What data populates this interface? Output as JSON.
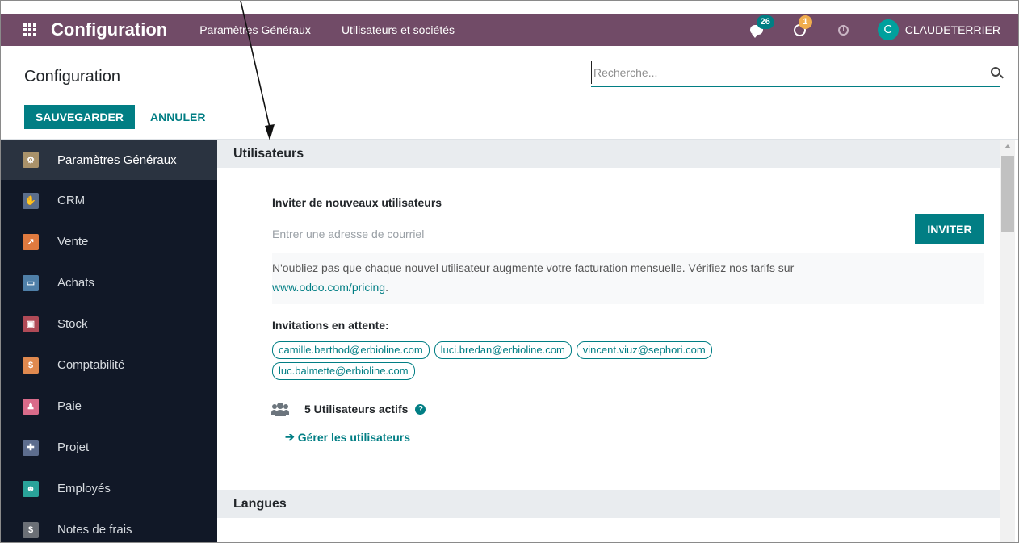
{
  "navbar": {
    "brand": "Configuration",
    "menu": [
      "Paramètres Généraux",
      "Utilisateurs et sociétés"
    ],
    "messages_count": "26",
    "activities_count": "1",
    "avatar_letter": "C",
    "user_name": "CLAUDETERRIER",
    "icons": [
      "apps-grid-icon",
      "chat-icon",
      "activity-icon",
      "clock-icon"
    ]
  },
  "control_panel": {
    "title": "Configuration",
    "search_placeholder": "Recherche...",
    "save_label": "SAUVEGARDER",
    "cancel_label": "ANNULER"
  },
  "sidebar": {
    "items": [
      {
        "label": "Paramètres Généraux",
        "color": "#a9926a",
        "glyph": "⚙"
      },
      {
        "label": "CRM",
        "color": "#5b6e8c",
        "glyph": "✋"
      },
      {
        "label": "Vente",
        "color": "#e07a3f",
        "glyph": "↗"
      },
      {
        "label": "Achats",
        "color": "#4f7fa8",
        "glyph": "▭"
      },
      {
        "label": "Stock",
        "color": "#b04a57",
        "glyph": "▣"
      },
      {
        "label": "Comptabilité",
        "color": "#e0894f",
        "glyph": "$"
      },
      {
        "label": "Paie",
        "color": "#d96b8a",
        "glyph": "♟"
      },
      {
        "label": "Projet",
        "color": "#5d6d8e",
        "glyph": "✚"
      },
      {
        "label": "Employés",
        "color": "#2aa39a",
        "glyph": "☻"
      },
      {
        "label": "Notes de frais",
        "color": "#6b6f76",
        "glyph": "$"
      }
    ]
  },
  "users_section": {
    "heading": "Utilisateurs",
    "invite_title": "Inviter de nouveaux utilisateurs",
    "invite_placeholder": "Entrer une adresse de courriel",
    "invite_button": "INVITER",
    "notice_text": "N'oubliez pas que chaque nouvel utilisateur augmente votre facturation mensuelle. Vérifiez nos tarifs sur",
    "notice_link": "www.odoo.com/pricing",
    "notice_end": ".",
    "pending_title": "Invitations en attente:",
    "pending": [
      "camille.berthod@erbioline.com",
      "luci.bredan@erbioline.com",
      "vincent.viuz@sephori.com",
      "luc.balmette@erbioline.com"
    ],
    "active_users": "5 Utilisateurs actifs",
    "help_glyph": "?",
    "manage_link": "Gérer les utilisateurs"
  },
  "languages_section": {
    "heading": "Langues"
  },
  "colors": {
    "navbar": "#714B67",
    "accent": "#017E84",
    "sidebar": "#111827"
  }
}
